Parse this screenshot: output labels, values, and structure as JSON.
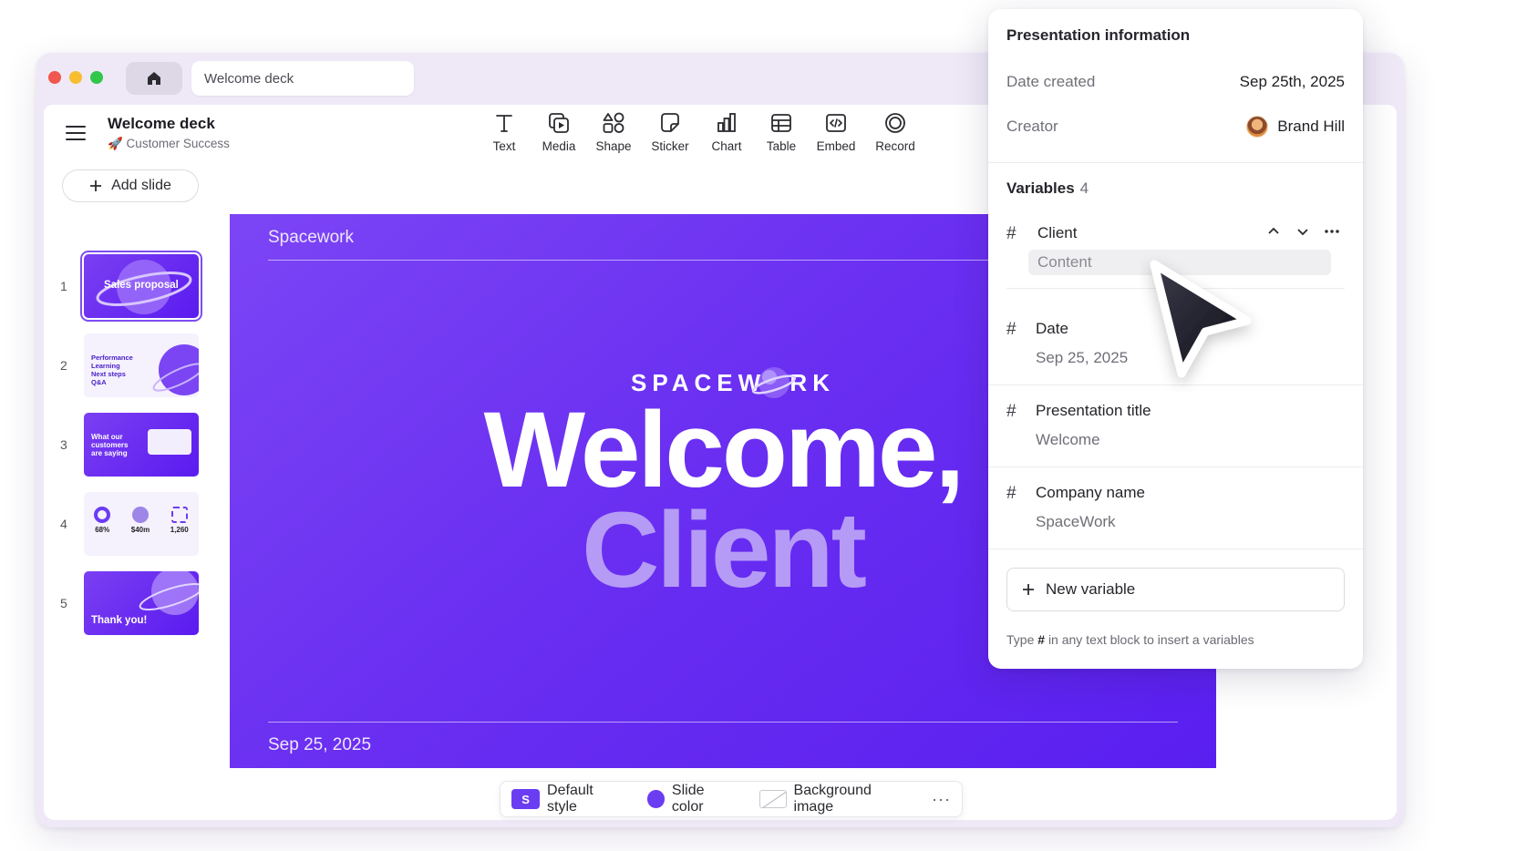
{
  "window": {
    "tab_title": "Welcome deck"
  },
  "header": {
    "deck_title": "Welcome deck",
    "deck_subtitle": "🚀 Customer Success",
    "tools": [
      {
        "label": "Text",
        "icon": "text-icon"
      },
      {
        "label": "Media",
        "icon": "media-icon"
      },
      {
        "label": "Shape",
        "icon": "shape-icon"
      },
      {
        "label": "Sticker",
        "icon": "sticker-icon"
      },
      {
        "label": "Chart",
        "icon": "chart-icon"
      },
      {
        "label": "Table",
        "icon": "table-icon"
      },
      {
        "label": "Embed",
        "icon": "embed-icon"
      },
      {
        "label": "Record",
        "icon": "record-icon"
      }
    ]
  },
  "sidebar": {
    "add_slide_label": "Add slide",
    "slides": [
      {
        "number": "1",
        "caption": "Sales proposal"
      },
      {
        "number": "2",
        "caption": "Performance Learning Next steps Q&A"
      },
      {
        "number": "3",
        "caption": "What our customers are saying"
      },
      {
        "number": "4",
        "caption": "68% $40m 1,260"
      },
      {
        "number": "5",
        "caption": "Thank you!"
      }
    ],
    "slide2_items": [
      "Performance",
      "Learning",
      "Next steps",
      "Q&A"
    ],
    "slide4_stats": [
      "68%",
      "$40m",
      "1,260"
    ]
  },
  "slide": {
    "brand": "Spacework",
    "logo": "SPACEWORK",
    "headline_1": "Welcome,",
    "headline_2": "Client",
    "date": "Sep 25, 2025"
  },
  "style_bar": {
    "badge": "S",
    "default_style": "Default style",
    "slide_color": "Slide color",
    "background_image": "Background image",
    "more": "···"
  },
  "panel": {
    "title": "Presentation information",
    "date_created_label": "Date created",
    "date_created_value": "Sep 25th, 2025",
    "creator_label": "Creator",
    "creator_value": "Brand Hill",
    "variables_label": "Variables",
    "variables_count": "4",
    "variables": [
      {
        "name": "Client",
        "value": "Content"
      },
      {
        "name": "Date",
        "value": "Sep 25, 2025"
      },
      {
        "name": "Presentation title",
        "value": "Welcome"
      },
      {
        "name": "Company name",
        "value": "SpaceWork"
      }
    ],
    "new_variable_label": "New variable",
    "hint_prefix": "Type",
    "hint_symbol": "#",
    "hint_suffix": "in any text block to insert a variables"
  },
  "colors": {
    "accent": "#6a3cf2",
    "slide_bg": "#6a2ff1",
    "headline_secondary": "#b59bf6"
  }
}
